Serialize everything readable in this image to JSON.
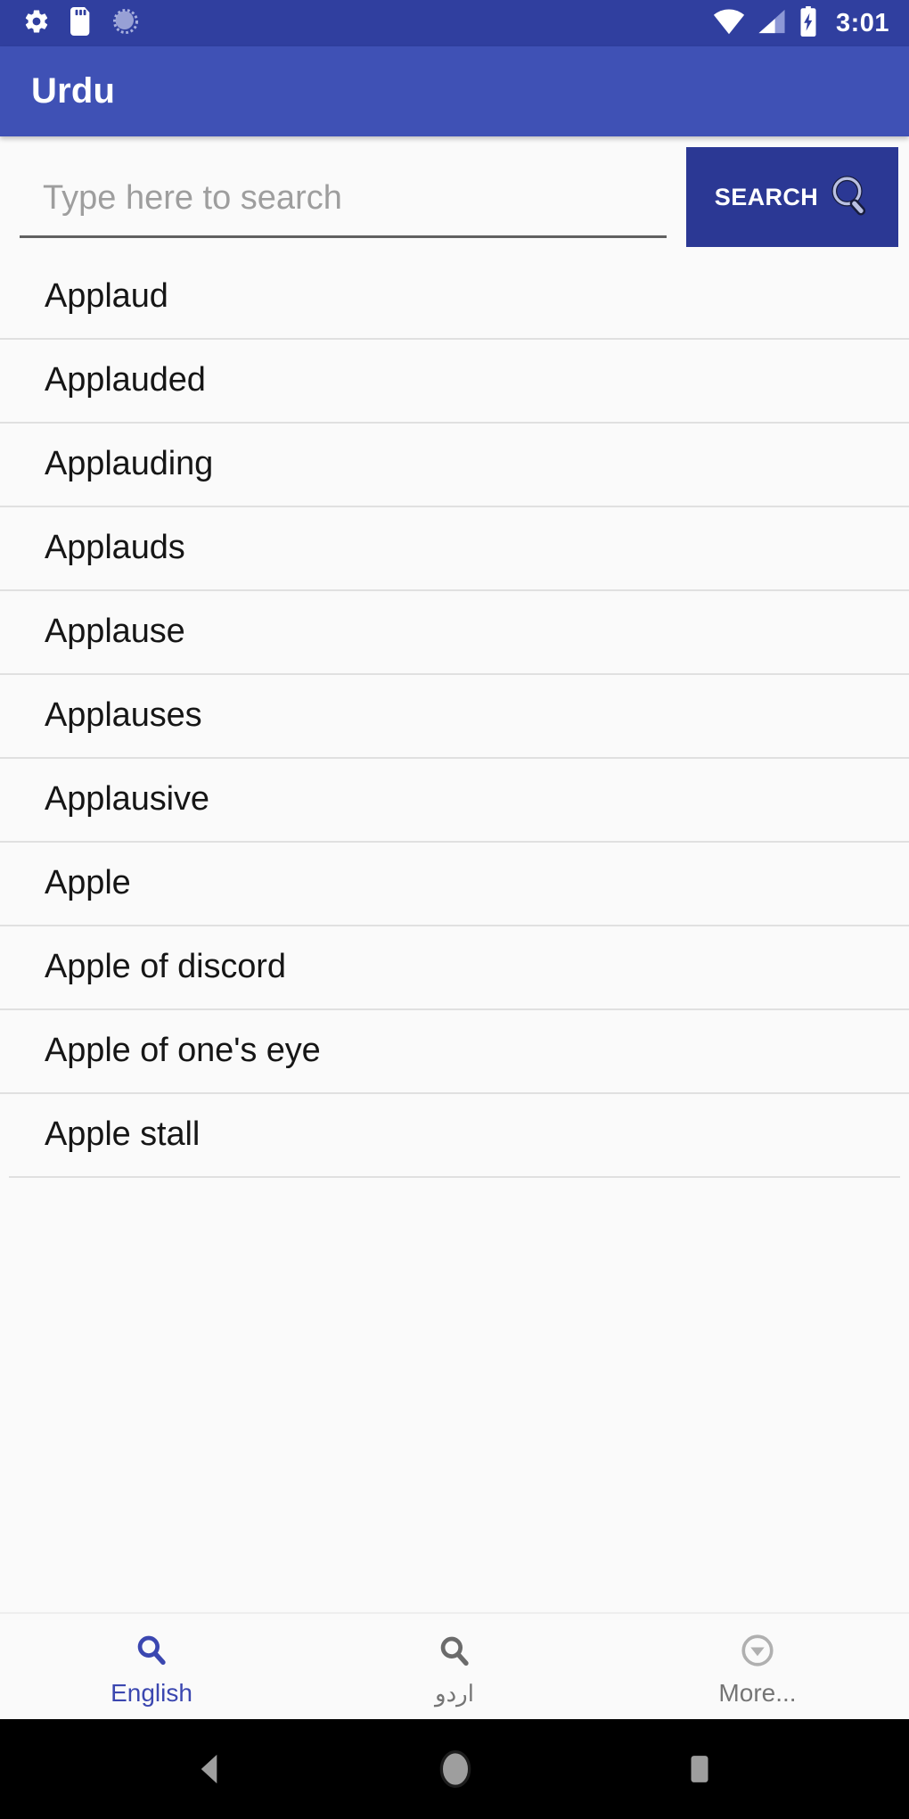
{
  "status_bar": {
    "icons_left": [
      "settings-gear-icon",
      "sd-card-icon",
      "sync-spinner-icon"
    ],
    "icons_right": [
      "wifi-icon",
      "cellular-signal-icon",
      "battery-charging-icon"
    ],
    "time": "3:01",
    "background_color": "#303f9f"
  },
  "app_bar": {
    "title": "Urdu",
    "background_color": "#3f51b5",
    "text_color": "#ffffff"
  },
  "search": {
    "placeholder": "Type here to search",
    "value": "",
    "button_label": "SEARCH",
    "button_icon": "magnifier-icon",
    "button_color": "#2b3894"
  },
  "word_list": {
    "items": [
      {
        "word": "Applaud"
      },
      {
        "word": "Applauded"
      },
      {
        "word": "Applauding"
      },
      {
        "word": "Applauds"
      },
      {
        "word": "Applause"
      },
      {
        "word": "Applauses"
      },
      {
        "word": "Applausive"
      },
      {
        "word": "Apple"
      },
      {
        "word": "Apple of discord"
      },
      {
        "word": "Apple of one's eye"
      },
      {
        "word": "Apple stall"
      }
    ],
    "divider_color": "#e0e0e0",
    "text_color": "#161616"
  },
  "bottom_nav": {
    "items": [
      {
        "label": "English",
        "icon": "magnifier-icon",
        "active": true,
        "color": "#3b47b0"
      },
      {
        "label": "اردو",
        "icon": "magnifier-icon",
        "active": false,
        "color": "#757575"
      },
      {
        "label": "More...",
        "icon": "circle-chevron-down-icon",
        "active": false,
        "color": "#757575"
      }
    ]
  },
  "system_nav": {
    "buttons": [
      "back-button",
      "home-button",
      "recents-button"
    ],
    "background_color": "#000000",
    "icon_color": "#9e9e9e"
  }
}
